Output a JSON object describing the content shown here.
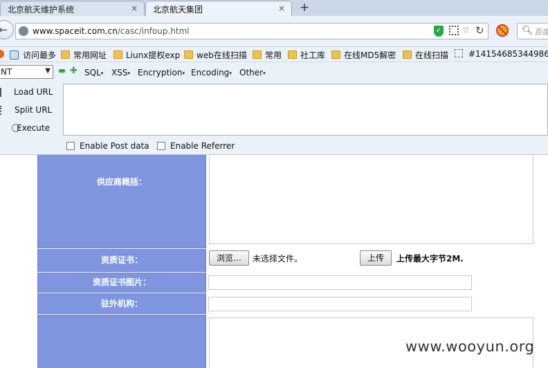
{
  "tabs": [
    {
      "label": "北京航天维护系统",
      "close": "×"
    },
    {
      "label": "北京航天集团",
      "close": "×"
    }
  ],
  "new_tab_glyph": "+",
  "navbar": {
    "url_host": "www.spaceit.com.cn",
    "url_path": "/casc/infoup.html",
    "search_placeholder": "百度"
  },
  "bookmarks": [
    {
      "label": "访问最多",
      "kind": "history"
    },
    {
      "label": "常用网址",
      "kind": "folder"
    },
    {
      "label": "Liunx提权exp",
      "kind": "folder"
    },
    {
      "label": "web在线扫描",
      "kind": "folder"
    },
    {
      "label": "常用",
      "kind": "folder"
    },
    {
      "label": "社工库",
      "kind": "folder"
    },
    {
      "label": "在线MD5解密",
      "kind": "folder"
    },
    {
      "label": "在线扫描",
      "kind": "folder"
    },
    {
      "label": "#14154685344986",
      "kind": "page"
    }
  ],
  "hackbar": {
    "select_value": "NT",
    "menus": [
      "SQL",
      "XSS",
      "Encryption",
      "Encoding",
      "Other"
    ],
    "actions": [
      "Load URL",
      "Split URL",
      "Execute"
    ],
    "checkboxes": [
      "Enable Post data",
      "Enable Referrer"
    ]
  },
  "form": {
    "supplier_overview_label": "供应商概括：",
    "qualification_label": "资质证书：",
    "browse_button": "浏览…",
    "no_file_text": "未选择文件。",
    "upload_button": "上传",
    "upload_hint": "上传最大字节2M.",
    "qualification_image_label": "资质证书图片：",
    "overseas_org_label": "驻外机构："
  },
  "watermark": "www.wooyun.org"
}
